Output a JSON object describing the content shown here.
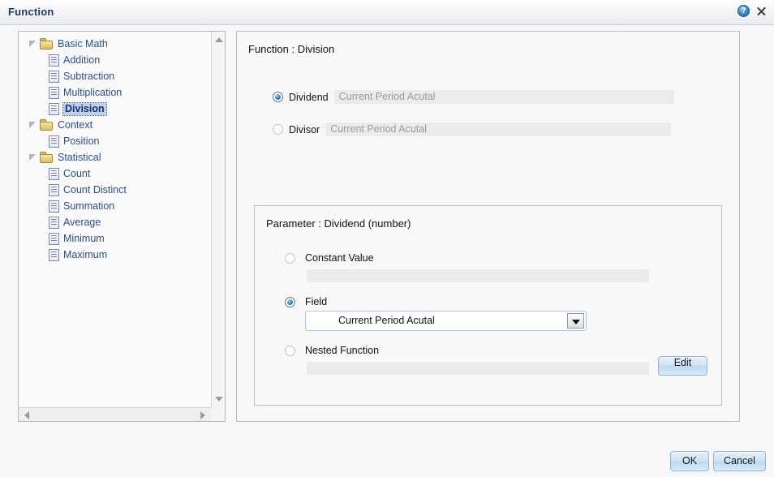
{
  "window": {
    "title": "Function",
    "help_icon": "help-circle-icon",
    "help_glyph": "?",
    "close_icon": "close-icon"
  },
  "tree": {
    "nodes": [
      {
        "label": "Basic Math",
        "type": "folder",
        "level": 0,
        "expanded": true,
        "selected": false
      },
      {
        "label": "Addition",
        "type": "leaf",
        "level": 1,
        "expanded": false,
        "selected": false
      },
      {
        "label": "Subtraction",
        "type": "leaf",
        "level": 1,
        "expanded": false,
        "selected": false
      },
      {
        "label": "Multiplication",
        "type": "leaf",
        "level": 1,
        "expanded": false,
        "selected": false
      },
      {
        "label": "Division",
        "type": "leaf",
        "level": 1,
        "expanded": false,
        "selected": true
      },
      {
        "label": "Context",
        "type": "folder",
        "level": 0,
        "expanded": true,
        "selected": false
      },
      {
        "label": "Position",
        "type": "leaf",
        "level": 1,
        "expanded": false,
        "selected": false
      },
      {
        "label": "Statistical",
        "type": "folder",
        "level": 0,
        "expanded": true,
        "selected": false
      },
      {
        "label": "Count",
        "type": "leaf",
        "level": 1,
        "expanded": false,
        "selected": false
      },
      {
        "label": "Count Distinct",
        "type": "leaf",
        "level": 1,
        "expanded": false,
        "selected": false
      },
      {
        "label": "Summation",
        "type": "leaf",
        "level": 1,
        "expanded": false,
        "selected": false
      },
      {
        "label": "Average",
        "type": "leaf",
        "level": 1,
        "expanded": false,
        "selected": false
      },
      {
        "label": "Minimum",
        "type": "leaf",
        "level": 1,
        "expanded": false,
        "selected": false
      },
      {
        "label": "Maximum",
        "type": "leaf",
        "level": 1,
        "expanded": false,
        "selected": false
      }
    ],
    "scrollbars": {
      "up_arrow_icon": "scroll-up-arrow-icon",
      "down_arrow_icon": "scroll-down-arrow-icon",
      "left_arrow_icon": "scroll-left-arrow-icon",
      "right_arrow_icon": "scroll-right-arrow-icon"
    }
  },
  "content": {
    "heading": "Function : Division",
    "operands": [
      {
        "label": "Dividend",
        "value": "Current Period Acutal",
        "selected": true
      },
      {
        "label": "Divisor",
        "value": "Current Period Acutal",
        "selected": false
      }
    ]
  },
  "parameter": {
    "heading": "Parameter : Dividend (number)",
    "options": [
      {
        "label": "Constant Value",
        "selected": false
      },
      {
        "label": "Field",
        "selected": true
      },
      {
        "label": "Nested Function",
        "selected": false
      }
    ],
    "constant_value": "",
    "field_value": "Current Period Acutal",
    "field_dropdown_icon": "chevron-down-icon",
    "nested_value": "",
    "edit_label": "Edit"
  },
  "footer": {
    "ok_label": "OK",
    "cancel_label": "Cancel"
  },
  "colors": {
    "accent": "#2a4d8f",
    "title": "#1b3a67",
    "selection": "#b8d2ef",
    "radio_on": "#2b86cf",
    "button": "#cfe3f5"
  }
}
